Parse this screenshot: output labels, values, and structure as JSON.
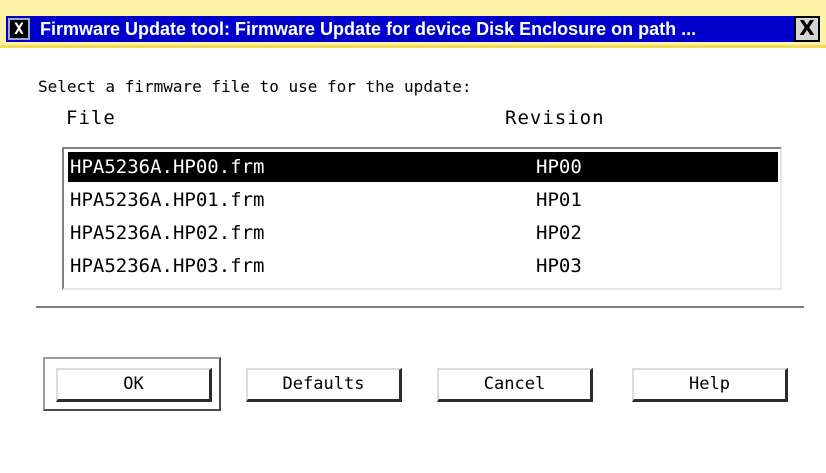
{
  "window": {
    "title": "Firmware Update tool: Firmware Update for device Disk Enclosure on path ...",
    "icon": "X",
    "close_label": "X"
  },
  "prompt": "Select a firmware file to use for the update:",
  "columns": {
    "file": "File",
    "revision": "Revision"
  },
  "files": [
    {
      "file": "HPA5236A.HP00.frm",
      "revision": "HP00",
      "selected": true
    },
    {
      "file": "HPA5236A.HP01.frm",
      "revision": "HP01",
      "selected": false
    },
    {
      "file": "HPA5236A.HP02.frm",
      "revision": "HP02",
      "selected": false
    },
    {
      "file": "HPA5236A.HP03.frm",
      "revision": "HP03",
      "selected": false
    }
  ],
  "buttons": {
    "ok": "OK",
    "defaults": "Defaults",
    "cancel": "Cancel",
    "help": "Help"
  }
}
